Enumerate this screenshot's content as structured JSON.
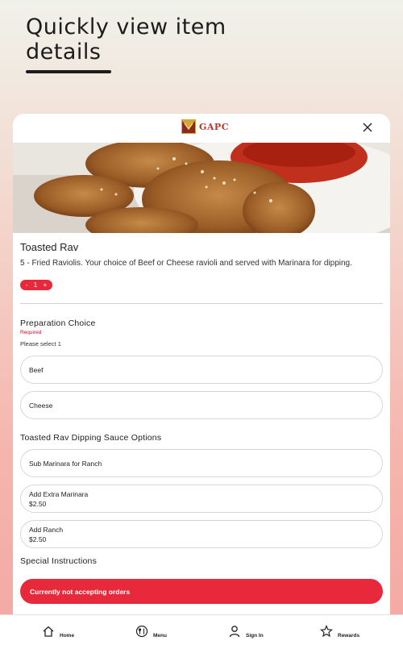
{
  "promo": {
    "title_line1": "Quickly view item",
    "title_line2": "details"
  },
  "modal": {
    "logo_text": "GAPC",
    "item": {
      "name": "Toasted Rav",
      "description": "5 - Fried Raviolis. Your choice of Beef or Cheese ravioli and served with Marinara for dipping.",
      "quantity": "1",
      "decrement": "-",
      "increment": "+"
    },
    "preparation": {
      "title": "Preparation Choice",
      "required": "Required",
      "hint": "Please select 1",
      "options": [
        {
          "label": "Beef"
        },
        {
          "label": "Cheese"
        }
      ]
    },
    "sauce": {
      "title": "Toasted Rav Dipping Sauce Options",
      "options": [
        {
          "label": "Sub Marinara for Ranch",
          "price": ""
        },
        {
          "label": "Add Extra Marinara",
          "price": "$2.50"
        },
        {
          "label": "Add Ranch",
          "price": "$2.50"
        }
      ]
    },
    "special_instructions": {
      "title": "Special Instructions"
    },
    "status_message": "Currently not accepting orders"
  },
  "nav": [
    {
      "label": "Home",
      "icon": "home-icon"
    },
    {
      "label": "Menu",
      "icon": "menu-icon"
    },
    {
      "label": "Sign In",
      "icon": "person-icon"
    },
    {
      "label": "Rewards",
      "icon": "star-icon"
    }
  ],
  "colors": {
    "accent": "#e8293c",
    "required": "#c8102e",
    "brand": "#b8352a"
  }
}
